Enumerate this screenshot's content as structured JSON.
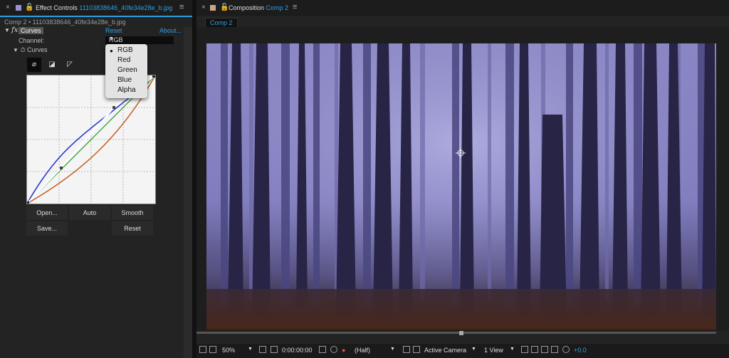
{
  "effect_controls": {
    "tab_close": "×",
    "tab_title_prefix": "Effect Controls",
    "tab_title_file": "11103838646_40fe34e28e_b.jpg",
    "comp_line": "Comp 2 • 11103838646_40fe34e28e_b.jpg",
    "fx_symbol": "fx",
    "effect_name": "Curves",
    "reset_link": "Reset",
    "about_link": "About...",
    "channel_label": "Channel:",
    "channel_value": "RGB",
    "curves_sublabel": "Curves",
    "buttons": {
      "open": "Open...",
      "auto": "Auto",
      "smooth": "Smooth",
      "save": "Save...",
      "reset": "Reset"
    },
    "channel_options": [
      "RGB",
      "Red",
      "Green",
      "Blue",
      "Alpha"
    ],
    "selected_option": "RGB"
  },
  "composition": {
    "tab_close": "×",
    "tab_title_prefix": "Composition",
    "tab_title_comp": "Comp 2",
    "comp_chip": "Comp 2"
  },
  "viewer_toolbar": {
    "zoom": "50%",
    "timecode": "0:00:00:00",
    "resolution": "(Half)",
    "camera": "Active Camera",
    "views": "1 View",
    "exposure": "+0.0"
  },
  "colors": {
    "accent": "#2fa0e0",
    "panel": "#232323",
    "fog": "#6a6aa8"
  },
  "icons": [
    "close-icon",
    "effect-icon",
    "lock-icon",
    "menu-icon",
    "composition-icon",
    "chevron-down-icon",
    "stopwatch-icon"
  ]
}
